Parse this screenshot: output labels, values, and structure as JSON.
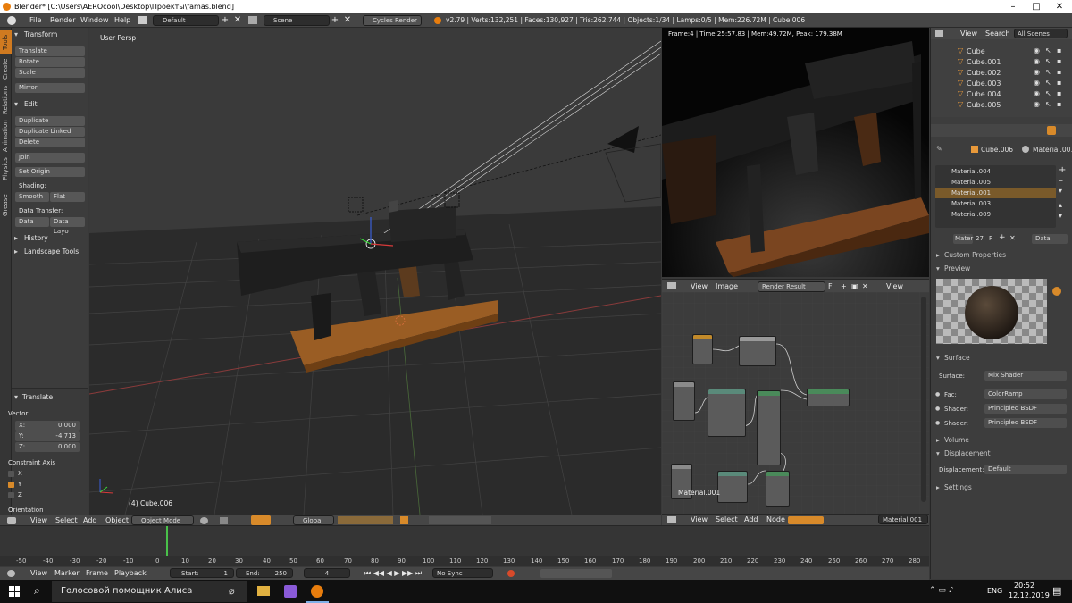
{
  "window": {
    "title": "Blender* [C:\\Users\\AEROcool\\Desktop\\Проекты\\famas.blend]"
  },
  "menu": {
    "file": "File",
    "render": "Render",
    "window": "Window",
    "help": "Help"
  },
  "screen_layout": "Default",
  "scene": "Scene",
  "engine": "Cycles Render",
  "stats": "v2.79 | Verts:132,251 | Faces:130,927 | Tris:262,744 | Objects:1/34 | Lamps:0/5 | Mem:226.72M | Cube.006",
  "tool_tabs": [
    "Tools",
    "Create",
    "Relations",
    "Animation",
    "Physics",
    "Grease Pencil"
  ],
  "toolshelf": {
    "transform_header": "Transform",
    "translate": "Translate",
    "rotate": "Rotate",
    "scale": "Scale",
    "mirror": "Mirror",
    "edit_header": "Edit",
    "duplicate": "Duplicate",
    "duplicate_linked": "Duplicate Linked",
    "delete": "Delete",
    "join": "Join",
    "set_origin": "Set Origin",
    "shading_label": "Shading:",
    "smooth": "Smooth",
    "flat": "Flat",
    "data_transfer_label": "Data Transfer:",
    "data": "Data",
    "data_layo": "Data Layo",
    "history": "History",
    "landscape_tools": "Landscape Tools"
  },
  "operator_panel": {
    "header": "Translate",
    "vector_label": "Vector",
    "x_label": "X:",
    "x_value": "0.000",
    "y_label": "Y:",
    "y_value": "-4.713",
    "z_label": "Z:",
    "z_value": "0.000",
    "constraint_label": "Constraint Axis",
    "axis_x": "X",
    "axis_y": "Y",
    "axis_z": "Z",
    "orientation_label": "Orientation"
  },
  "viewport": {
    "view_label": "User Persp",
    "object_label": "(4) Cube.006"
  },
  "viewport_header": {
    "view": "View",
    "select": "Select",
    "add": "Add",
    "object": "Object",
    "mode": "Object Mode",
    "orientation": "Global"
  },
  "render_view": {
    "info": "Frame:4 | Time:25:57.83 | Mem:49.72M, Peak: 179.38M"
  },
  "image_header": {
    "view": "View",
    "image": "Image",
    "image_name": "Render Result",
    "f_label": "F",
    "view2": "View"
  },
  "node_editor": {
    "frame_label": "Material.001"
  },
  "node_header": {
    "view": "View",
    "select": "Select",
    "add": "Add",
    "node": "Node",
    "material": "Material.001"
  },
  "outliner": {
    "view": "View",
    "search": "Search",
    "filter": "All Scenes",
    "items": [
      {
        "name": "Cube"
      },
      {
        "name": "Cube.001"
      },
      {
        "name": "Cube.002"
      },
      {
        "name": "Cube.003"
      },
      {
        "name": "Cube.004"
      },
      {
        "name": "Cube.005"
      }
    ]
  },
  "properties": {
    "object": "Cube.006",
    "material": "Material.001",
    "materials": [
      "Material.004",
      "Material.005",
      "Material.001",
      "Material.003",
      "Material.009"
    ],
    "selected_index": 2,
    "mat_field": "Mater",
    "mat_users": "27",
    "f_label": "F",
    "data_label": "Data",
    "custom_properties": "Custom Properties",
    "preview": "Preview",
    "surface_header": "Surface",
    "surface_label": "Surface:",
    "surface_value": "Mix Shader",
    "fac_label": "Fac:",
    "fac_value": "ColorRamp",
    "shader1_label": "Shader:",
    "shader1_value": "Principled BSDF",
    "shader2_label": "Shader:",
    "shader2_value": "Principled BSDF",
    "volume": "Volume",
    "displacement_header": "Displacement",
    "displacement_label": "Displacement:",
    "displacement_value": "Default",
    "settings": "Settings"
  },
  "timeline": {
    "ticks": [
      "-50",
      "-40",
      "-30",
      "-20",
      "-10",
      "0",
      "10",
      "20",
      "30",
      "40",
      "50",
      "60",
      "70",
      "80",
      "90",
      "100",
      "110",
      "120",
      "130",
      "140",
      "150",
      "160",
      "170",
      "180",
      "190",
      "200",
      "210",
      "220",
      "230",
      "240",
      "250",
      "260",
      "270",
      "280"
    ],
    "current_frame": 4
  },
  "timeline_header": {
    "view": "View",
    "marker": "Marker",
    "frame": "Frame",
    "playback": "Playback",
    "start_label": "Start:",
    "start_value": "1",
    "end_label": "End:",
    "end_value": "250",
    "current": "4",
    "sync": "No Sync"
  },
  "taskbar": {
    "search_text": "Голосовой помощник Алиса",
    "lang": "ENG",
    "time": "20:52",
    "date": "12.12.2019"
  },
  "colors": {
    "accent_orange": "#e87d0d",
    "selected_row": "#7a5a2a",
    "header": "#464646"
  }
}
